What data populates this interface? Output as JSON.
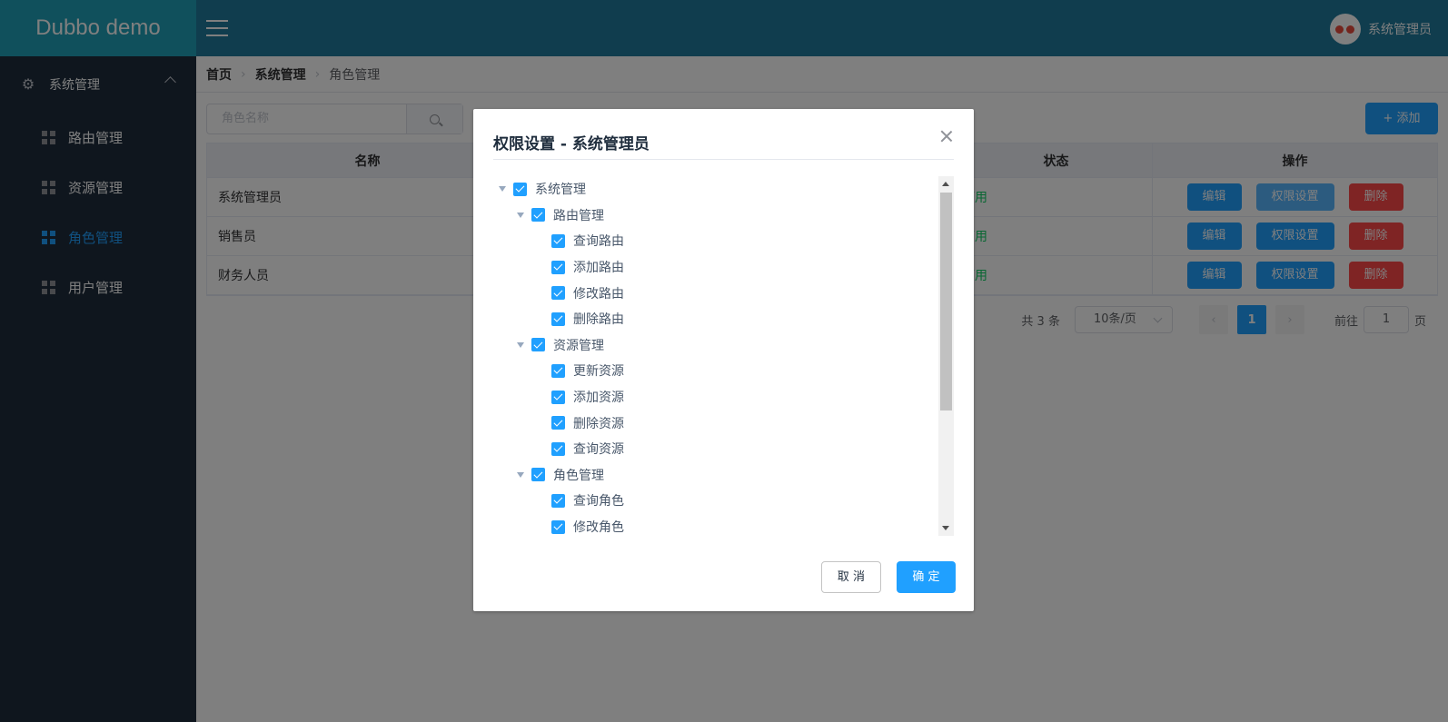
{
  "app": {
    "logo": "Dubbo demo",
    "user_name": "系统管理员"
  },
  "sidebar": {
    "group_label": "系统管理",
    "items": [
      {
        "label": "路由管理",
        "active": false
      },
      {
        "label": "资源管理",
        "active": false
      },
      {
        "label": "角色管理",
        "active": true
      },
      {
        "label": "用户管理",
        "active": false
      }
    ]
  },
  "breadcrumb": {
    "home": "首页",
    "section": "系统管理",
    "current": "角色管理"
  },
  "search": {
    "placeholder": "角色名称"
  },
  "toolbar": {
    "add_label": "添加"
  },
  "table": {
    "headers": {
      "name": "名称",
      "status": "状态",
      "ops": "操作"
    },
    "rows": [
      {
        "name": "系统管理员",
        "status": "可用"
      },
      {
        "name": "销售员",
        "status": "可用"
      },
      {
        "name": "财务人员",
        "status": "可用"
      }
    ],
    "btn_edit": "编辑",
    "btn_perm": "权限设置",
    "btn_delete": "删除"
  },
  "pagination": {
    "total": "共 3 条",
    "page_size": "10条/页",
    "current_page": "1",
    "goto_prefix": "前往",
    "goto_value": "1",
    "goto_suffix": "页"
  },
  "dialog": {
    "title": "权限设置 - 系统管理员",
    "cancel_label": "取 消",
    "ok_label": "确 定",
    "tree": [
      {
        "label": "系统管理",
        "level": 0,
        "checked": true,
        "expandable": true
      },
      {
        "label": "路由管理",
        "level": 1,
        "checked": true,
        "expandable": true
      },
      {
        "label": "查询路由",
        "level": 2,
        "checked": true
      },
      {
        "label": "添加路由",
        "level": 2,
        "checked": true
      },
      {
        "label": "修改路由",
        "level": 2,
        "checked": true
      },
      {
        "label": "删除路由",
        "level": 2,
        "checked": true
      },
      {
        "label": "资源管理",
        "level": 1,
        "checked": true,
        "expandable": true
      },
      {
        "label": "更新资源",
        "level": 2,
        "checked": true
      },
      {
        "label": "添加资源",
        "level": 2,
        "checked": true
      },
      {
        "label": "删除资源",
        "level": 2,
        "checked": true
      },
      {
        "label": "查询资源",
        "level": 2,
        "checked": true
      },
      {
        "label": "角色管理",
        "level": 1,
        "checked": true,
        "expandable": true
      },
      {
        "label": "查询角色",
        "level": 2,
        "checked": true
      },
      {
        "label": "修改角色",
        "level": 2,
        "checked": true
      }
    ]
  },
  "colors": {
    "primary": "#20a0ff",
    "danger": "#ff4949",
    "success": "#13ce66",
    "sidebar_bg": "#1f2d3d",
    "header_bg": "#217b9d"
  }
}
